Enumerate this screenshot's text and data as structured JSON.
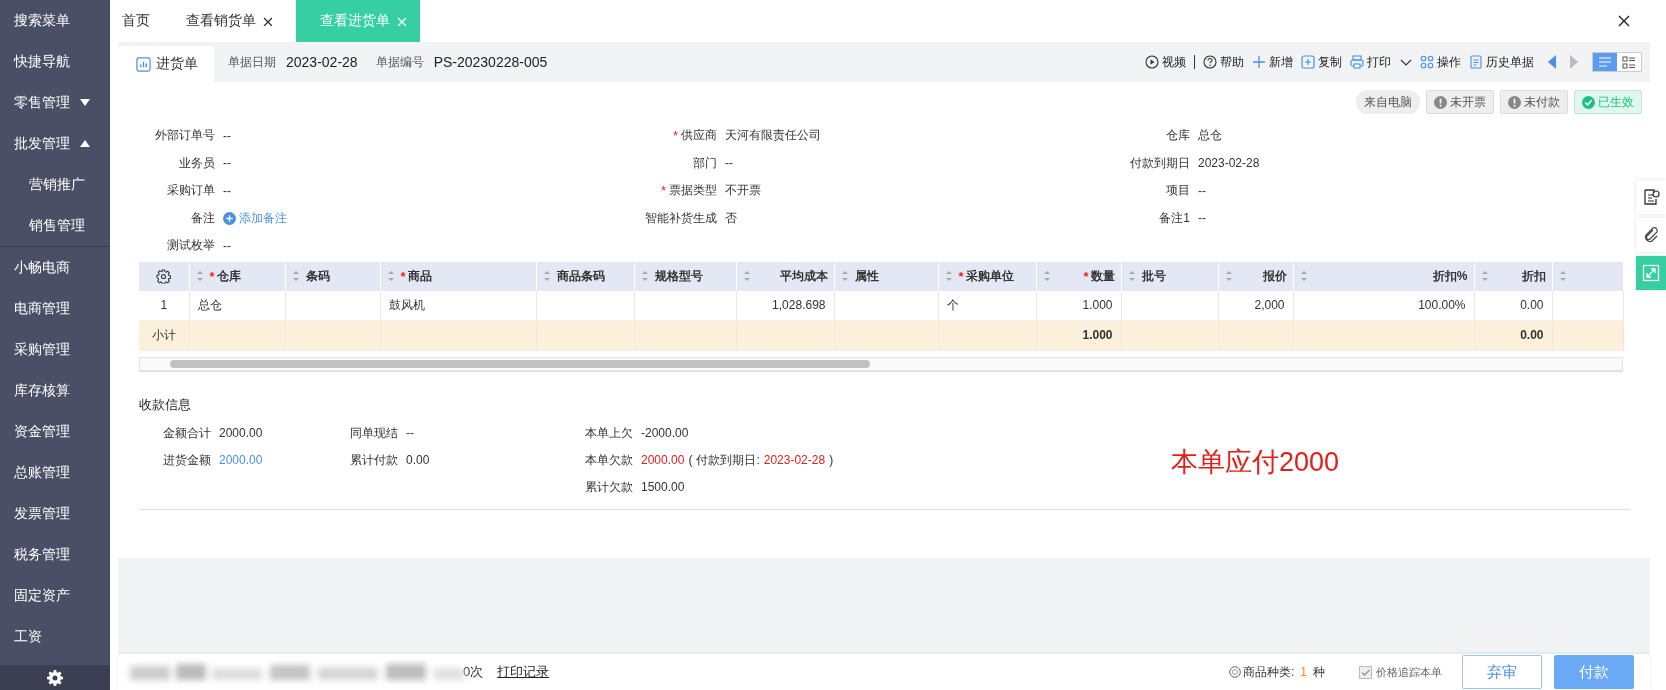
{
  "sidebar": {
    "items": [
      {
        "label": "搜索菜单"
      },
      {
        "label": "快捷导航"
      },
      {
        "label": "零售管理",
        "expanded": false
      },
      {
        "label": "批发管理",
        "expanded": true,
        "children": [
          {
            "label": "营销推广"
          },
          {
            "label": "销售管理"
          }
        ]
      },
      {
        "label": "小畅电商"
      },
      {
        "label": "电商管理"
      },
      {
        "label": "采购管理"
      },
      {
        "label": "库存核算"
      },
      {
        "label": "资金管理"
      },
      {
        "label": "总账管理"
      },
      {
        "label": "发票管理"
      },
      {
        "label": "税务管理"
      },
      {
        "label": "固定资产"
      },
      {
        "label": "工资"
      }
    ]
  },
  "tabs": [
    {
      "label": "首页",
      "closable": false,
      "selected": false
    },
    {
      "label": "查看销货单",
      "closable": true,
      "selected": false
    },
    {
      "label": "查看进货单",
      "closable": true,
      "selected": true
    }
  ],
  "document": {
    "tab_label": "进货单",
    "date_label": "单据日期",
    "date": "2023-02-28",
    "number_label": "单据编号",
    "number": "PS-20230228-005"
  },
  "toolbar": [
    {
      "label": "视频",
      "kind": "play"
    },
    {
      "label": "帮助",
      "kind": "help"
    },
    {
      "label": "新增",
      "kind": "plus"
    },
    {
      "label": "复制",
      "kind": "copy"
    },
    {
      "label": "打印",
      "kind": "print",
      "dropdown": true
    },
    {
      "label": "操作",
      "kind": "grid"
    },
    {
      "label": "历史单据",
      "kind": "doc"
    }
  ],
  "view_modes": [
    {
      "kind": "list",
      "selected": true
    },
    {
      "kind": "card",
      "selected": false
    }
  ],
  "badges": [
    {
      "label": "来自电脑",
      "kind": "source"
    },
    {
      "label": "未开票",
      "kind": "warning"
    },
    {
      "label": "未付款",
      "kind": "warning"
    },
    {
      "label": "已生效",
      "kind": "success"
    }
  ],
  "form": {
    "rows": [
      [
        {
          "label": "外部订单号",
          "value": "--"
        },
        {
          "label": "供应商",
          "value": "天河有限责任公司",
          "required_mark": "*"
        },
        {
          "label": "仓库",
          "value": "总仓"
        }
      ],
      [
        {
          "label": "业务员",
          "value": "--"
        },
        {
          "label": "部门",
          "value": "--"
        },
        {
          "label": "付款到期日",
          "value": "2023-02-28"
        }
      ],
      [
        {
          "label": "采购订单",
          "value": "--"
        },
        {
          "label": "票据类型",
          "value": "不开票",
          "required_mark": "*"
        },
        {
          "label": "项目",
          "value": "--"
        }
      ],
      [
        {
          "label": "备注",
          "value": "添加备注",
          "kind": "link"
        },
        {
          "label": "智能补货生成",
          "value": "否"
        },
        {
          "label": "备注1",
          "value": "--"
        }
      ],
      [
        {
          "label": "测试枚举",
          "value": "--"
        }
      ]
    ]
  },
  "table": {
    "columns": [
      {
        "kind": "settings"
      },
      {
        "label": "仓库",
        "required_mark": "*",
        "kind": "text"
      },
      {
        "label": "条码",
        "kind": "text"
      },
      {
        "label": "商品",
        "required_mark": "*",
        "kind": "text"
      },
      {
        "label": "商品条码",
        "kind": "text"
      },
      {
        "label": "规格型号",
        "kind": "text"
      },
      {
        "label": "平均成本",
        "kind": "number"
      },
      {
        "label": "属性",
        "kind": "text"
      },
      {
        "label": "采购单位",
        "required_mark": "*",
        "kind": "text"
      },
      {
        "label": "数量",
        "required_mark": "*",
        "kind": "number"
      },
      {
        "label": "批号",
        "kind": "text"
      },
      {
        "label": "报价",
        "kind": "number"
      },
      {
        "label": "折扣%",
        "kind": "number"
      },
      {
        "label": "折扣",
        "kind": "number"
      },
      {
        "kind": "text"
      }
    ],
    "rows": [
      [
        "1",
        "总仓",
        null,
        "鼓风机",
        null,
        null,
        "1,028.698",
        null,
        "个",
        "1.000",
        null,
        "2,000",
        "100.00%",
        "0.00",
        null
      ]
    ],
    "subtotal": {
      "label": "小计",
      "quantity": "1.000",
      "discount": "0.00"
    }
  },
  "payment": {
    "title": "收款信息",
    "rows": [
      [
        {
          "label": "金额合计",
          "value": "2000.00"
        },
        {
          "label": "同单现结",
          "value": "--"
        },
        {
          "label": "本单上欠",
          "value": "-2000.00"
        }
      ],
      [
        {
          "label": "进货金额",
          "value": "2000.00",
          "kind": "link"
        },
        {
          "label": "累计付款",
          "value": "0.00"
        },
        {
          "label": "本单欠款",
          "value": "2000.00",
          "kind": "alert",
          "detail": [
            {
              "text": "(",
              "kind": "plain"
            },
            {
              "text": "付款到期日:",
              "kind": "plain"
            },
            {
              "text": "2023-02-28",
              "kind": "alert"
            },
            {
              "text": ")",
              "kind": "plain"
            }
          ]
        }
      ],
      [
        null,
        null,
        {
          "label": "累计欠款",
          "value": "1500.00"
        }
      ]
    ],
    "note": "本单应付2000"
  },
  "footer": {
    "print_count": "0次",
    "print_log": "打印记录",
    "item_types_label": "商品种类:",
    "item_types": "1",
    "item_types_unit": "种",
    "price_tracking": {
      "label": "价格追踪本单",
      "checked": true,
      "disabled": true
    },
    "buttons": [
      {
        "label": "弃审",
        "kind": "secondary"
      },
      {
        "label": "付款",
        "kind": "primary"
      }
    ]
  }
}
